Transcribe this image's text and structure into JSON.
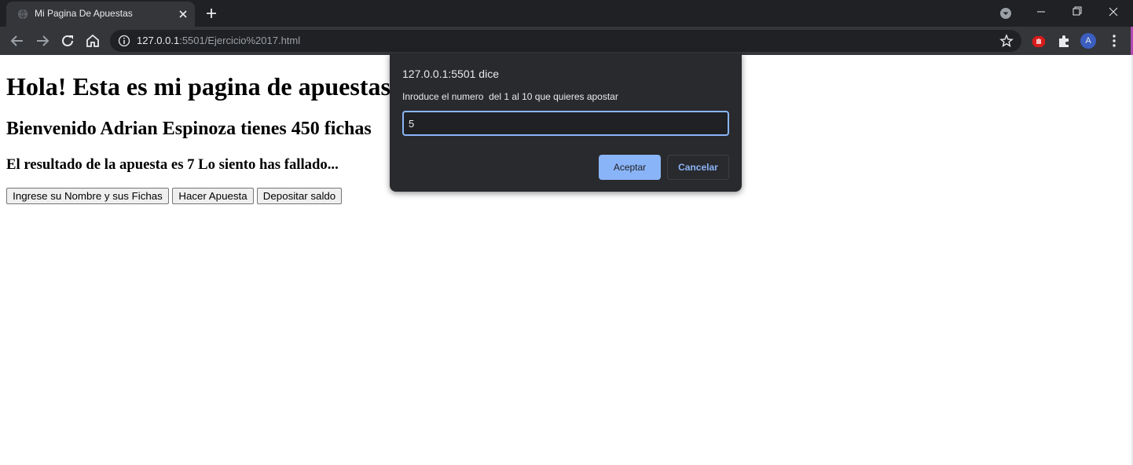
{
  "browser": {
    "tab_title": "Mi Pagina De Apuestas",
    "url_host": "127.0.0.1",
    "url_rest": ":5501/Ejercicio%2017.html",
    "profile_initial": "A"
  },
  "page": {
    "heading": "Hola! Esta es mi pagina de apuestas",
    "welcome": "Bienvenido Adrian Espinoza tienes 450 fichas",
    "result": "El resultado de la apuesta es 7 Lo siento has fallado...",
    "buttons": {
      "register": "Ingrese su Nombre y sus Fichas",
      "bet": "Hacer Apuesta",
      "deposit": "Depositar saldo"
    }
  },
  "dialog": {
    "title": "127.0.0.1:5501 dice",
    "message": "Inroduce el numero  del 1 al 10 que quieres apostar",
    "input_value": "5",
    "ok_label": "Aceptar",
    "cancel_label": "Cancelar"
  },
  "colors": {
    "dialog_bg": "#292a2d",
    "accent": "#8ab4f8",
    "tab_active": "#35363a",
    "titlebar": "#202124"
  }
}
